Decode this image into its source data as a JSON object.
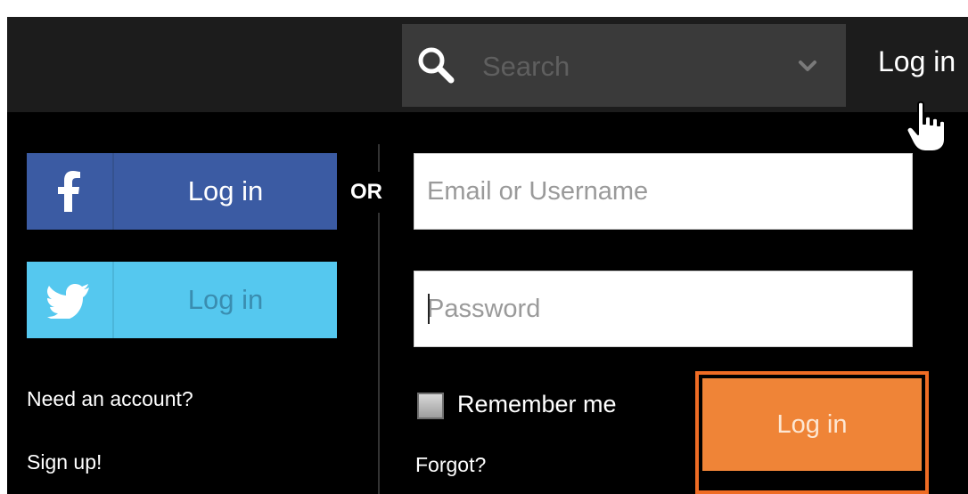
{
  "header": {
    "search": {
      "placeholder": "Search",
      "value": "",
      "icon": "search-icon",
      "dropdown_icon": "chevron-down-icon"
    },
    "login_link": "Log in",
    "cursor_icon": "hand-cursor-icon"
  },
  "social": {
    "facebook": {
      "label": "Log in",
      "icon": "facebook-icon",
      "color": "#3b5ba3"
    },
    "twitter": {
      "label": "Log in",
      "icon": "twitter-icon",
      "color": "#55c8ef"
    }
  },
  "separator": "OR",
  "form": {
    "email_placeholder": "Email or Username",
    "email_value": "",
    "password_placeholder": "Password",
    "password_value": "",
    "remember_label": "Remember me",
    "remember_checked": false,
    "forgot_label": "Forgot?",
    "submit_label": "Log in",
    "submit_color": "#ef8437",
    "highlight_color": "#ef6c24"
  },
  "footer": {
    "need_account": "Need an account?",
    "signup": "Sign up!"
  }
}
